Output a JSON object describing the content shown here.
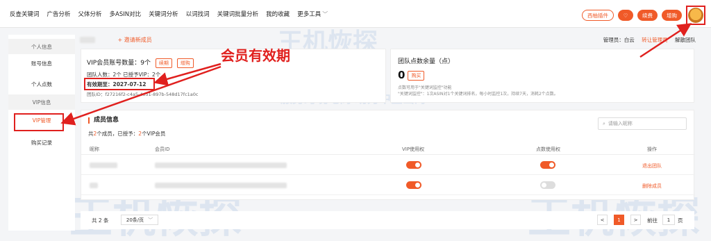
{
  "nav": {
    "items": [
      "反查关键词",
      "广告分析",
      "父体分析",
      "多ASIN对比",
      "关键词分析",
      "以词找词",
      "关键词批量分析",
      "我的收藏",
      "更多工具"
    ]
  },
  "topright": {
    "plugin": "西柚插件",
    "renew": "续费",
    "buy": "增购"
  },
  "sidebar": {
    "items": [
      "个人信息",
      "账号信息",
      "个人点数",
      "VIP信息",
      "VIP管理",
      "购买记录"
    ]
  },
  "member": {
    "invite": "+ 邀请新成员"
  },
  "admin": {
    "label": "管理员：",
    "name": "白云",
    "transfer": "转让管理员",
    "dissolve": "解散团队"
  },
  "vip_card": {
    "title": "VIP会员账号数量：9个",
    "renew_btn": "续期",
    "add_btn": "增购",
    "team_count": "团队人数：2个  已授予VIP：2个",
    "valid": "有效期至：2027-07-12",
    "team_id_label": "团队ID：",
    "team_id": "f27216f2-c4a5-4e51-897b-548d17fc1a0c"
  },
  "annotation": "会员有效期",
  "points_card": {
    "title": "团队点数余量（点）",
    "value": "0",
    "btn": "购买",
    "note1": "点数可用于\"关键词监控\"功能",
    "note2": "\"关键词监控\"：1次ASIN对1个关键词排名，每小时监控1次，持续7天，消耗2个点数。"
  },
  "members": {
    "title": "成员信息",
    "count_prefix": "共",
    "count_total": "2",
    "count_mid": "个成员，已授予：",
    "count_vip": "2",
    "count_suffix": "个VIP会员",
    "search_placeholder": "请输入昵称",
    "columns": [
      "昵称",
      "会员ID",
      "VIP使用权",
      "点数使用权",
      "操作"
    ],
    "rows": [
      {
        "vip": true,
        "points": true,
        "op": "退出团队"
      },
      {
        "vip": true,
        "points": false,
        "op": "删除成员"
      }
    ]
  },
  "pager": {
    "total": "共 2 条",
    "size": "20条/页",
    "prev": "<",
    "page": "1",
    "next": ">",
    "goto": "前往",
    "goto_page": "1",
    "unit": "页"
  },
  "watermark": {
    "logo": "王机恢探",
    "tagline": "服务跨境电商  助力中企出海"
  },
  "colors": {
    "accent": "#f05a28",
    "annotation": "#e0201e"
  }
}
